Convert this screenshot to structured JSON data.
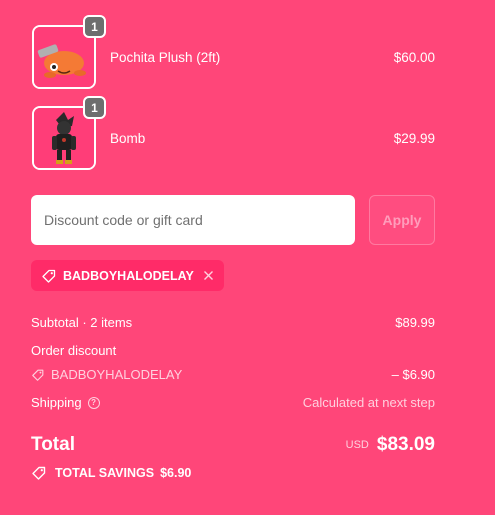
{
  "line_items": [
    {
      "name": "Pochita Plush (2ft)",
      "price": "$60.00",
      "quantity": "1",
      "image_icon": "pochita-plush-image"
    },
    {
      "name": "Bomb",
      "price": "$29.99",
      "quantity": "1",
      "image_icon": "bomb-figure-image"
    }
  ],
  "discount": {
    "placeholder": "Discount code or gift card",
    "value": "",
    "apply_label": "Apply",
    "applied_code": "BADBOYHALODELAY"
  },
  "summary": {
    "subtotal_label": "Subtotal · 2 items",
    "subtotal_value": "$89.99",
    "order_discount_label": "Order discount",
    "discount_code": "BADBOYHALODELAY",
    "discount_value": "– $6.90",
    "shipping_label": "Shipping",
    "shipping_value": "Calculated at next step",
    "total_label": "Total",
    "currency": "USD",
    "total_value": "$83.09",
    "savings_label": "TOTAL SAVINGS",
    "savings_value": "$6.90"
  },
  "colors": {
    "background": "#ff4679",
    "chip": "#ff2b68",
    "badge": "#6e6e6e"
  }
}
